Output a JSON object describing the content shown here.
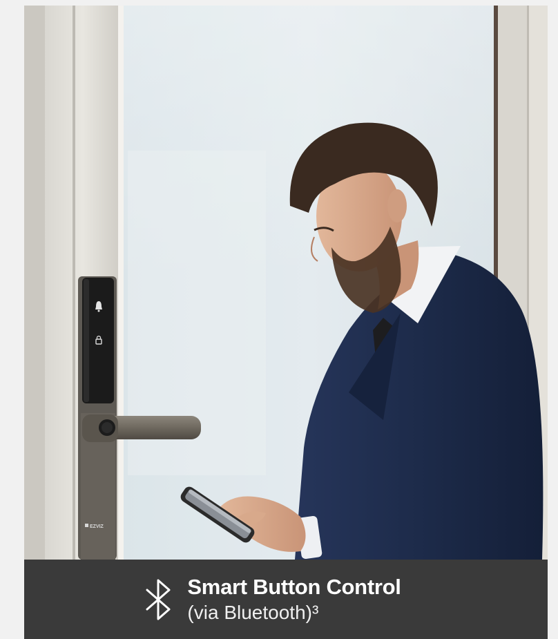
{
  "photo": {
    "description_icon": "man-with-phone-at-smart-lock-door",
    "lock_brand": "EZVIZ",
    "lock_icons": [
      "bell-icon",
      "lock-icon"
    ]
  },
  "caption": {
    "title": "Smart Button Control",
    "subtitle": "(via Bluetooth)³",
    "icon": "bluetooth-icon"
  },
  "colors": {
    "page_bg": "#f1f1f1",
    "caption_bg": "#3a3a3a",
    "caption_text": "#ffffff",
    "suit": "#1d2b4a"
  }
}
